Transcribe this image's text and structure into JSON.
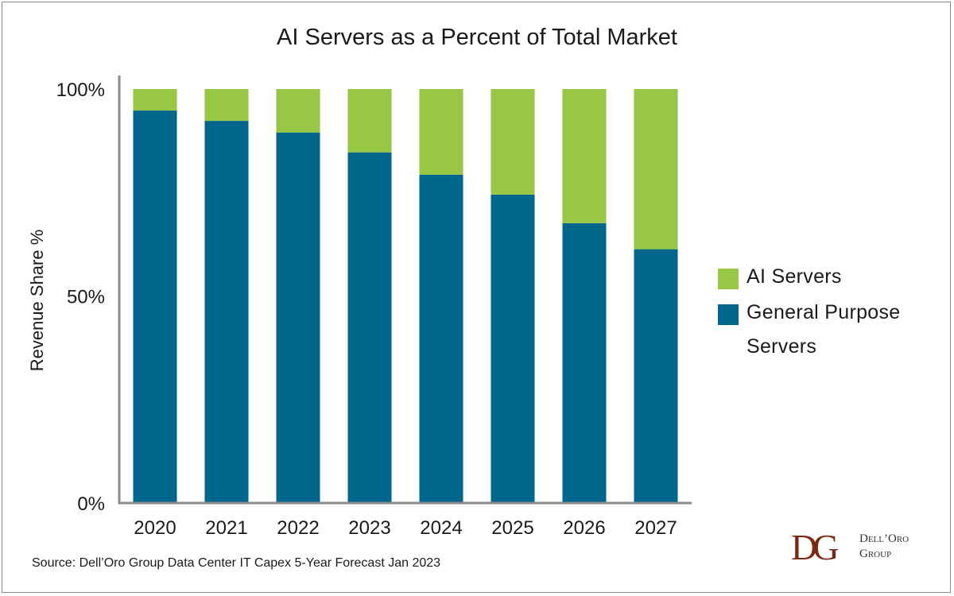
{
  "chart_data": {
    "type": "bar",
    "stacked": true,
    "title": "AI Servers as a Percent of Total Market",
    "xlabel": "",
    "ylabel": "Revenue Share %",
    "ylim": [
      0,
      100
    ],
    "yticks": [
      "0%",
      "50%",
      "100%"
    ],
    "ytick_values": [
      0,
      50,
      100
    ],
    "categories": [
      "2020",
      "2021",
      "2022",
      "2023",
      "2024",
      "2025",
      "2026",
      "2027"
    ],
    "series": [
      {
        "name": "General Purpose Servers",
        "color": "#01668b",
        "values": [
          94.8,
          92.3,
          89.5,
          84.7,
          79.3,
          74.5,
          67.6,
          61.3
        ]
      },
      {
        "name": "AI Servers",
        "color": "#97c744",
        "values": [
          5.2,
          7.7,
          10.5,
          15.3,
          20.7,
          25.5,
          32.4,
          38.7
        ]
      }
    ],
    "grid": false,
    "legend": "right"
  },
  "legend": {
    "items": [
      {
        "label": "AI Servers",
        "color": "#97c744"
      },
      {
        "label_lines": [
          "General Purpose",
          "Servers"
        ],
        "color": "#01668b"
      }
    ]
  },
  "source": "Source: Dell’Oro Group Data Center IT Capex 5-Year Forecast Jan 2023",
  "logo": {
    "mark": "DG",
    "line1": "Dell’Oro",
    "line2": "Group"
  }
}
